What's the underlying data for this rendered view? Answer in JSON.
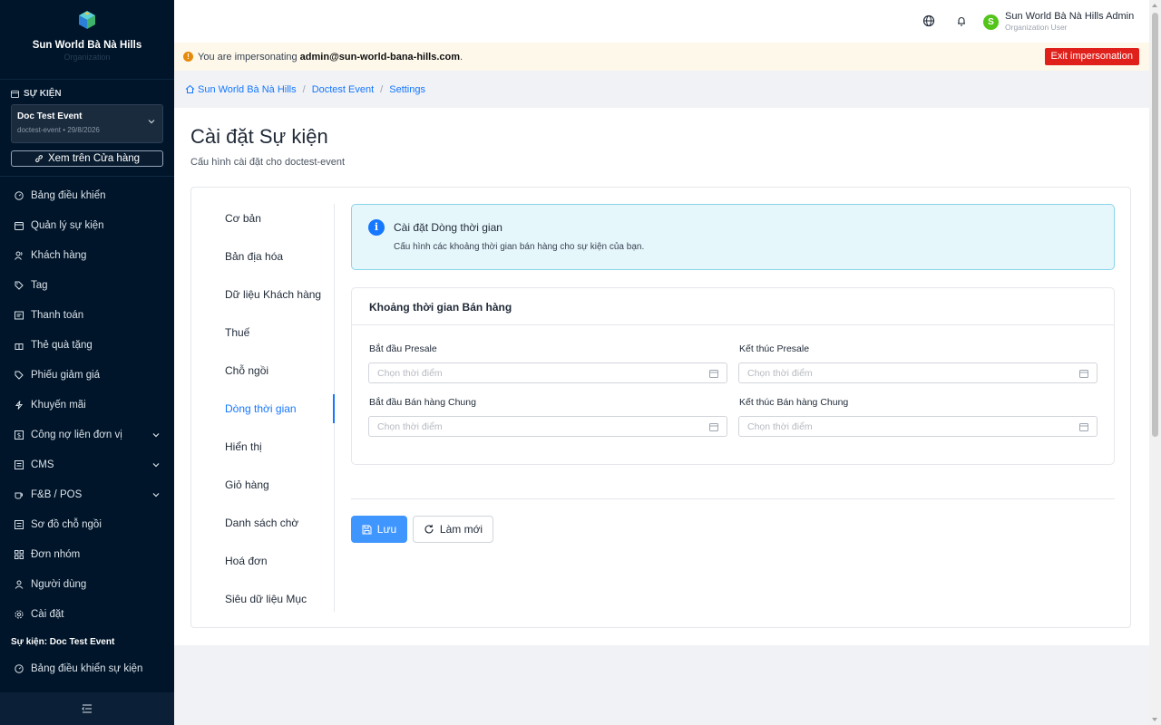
{
  "sidebar": {
    "org_name": "Sun World Bà Nà Hills",
    "org_subtitle": "Organization",
    "section_title": "SỰ KIỆN",
    "event_name": "Doc Test Event",
    "event_meta": "doctest-event • 29/8/2026",
    "store_button": "Xem trên Cửa hàng",
    "nav": [
      {
        "label": "Bảng điều khiển",
        "icon": "dashboard-icon"
      },
      {
        "label": "Quản lý sự kiện",
        "icon": "calendar-icon"
      },
      {
        "label": "Khách hàng",
        "icon": "users-icon"
      },
      {
        "label": "Tag",
        "icon": "tag-icon"
      },
      {
        "label": "Thanh toán",
        "icon": "payment-icon"
      },
      {
        "label": "Thẻ quà tặng",
        "icon": "gift-icon"
      },
      {
        "label": "Phiếu giảm giá",
        "icon": "coupon-icon"
      },
      {
        "label": "Khuyến mãi",
        "icon": "promotion-icon"
      },
      {
        "label": "Công nợ liên đơn vị",
        "icon": "ledger-icon",
        "expandable": true
      },
      {
        "label": "CMS",
        "icon": "cms-icon",
        "expandable": true
      },
      {
        "label": "F&B / POS",
        "icon": "coffee-icon",
        "expandable": true
      },
      {
        "label": "Sơ đồ chỗ ngồi",
        "icon": "seatmap-icon"
      },
      {
        "label": "Đơn nhóm",
        "icon": "group-order-icon"
      },
      {
        "label": "Người dùng",
        "icon": "user-icon"
      },
      {
        "label": "Cài đặt",
        "icon": "settings-icon"
      }
    ],
    "event_section": "Sự kiện: Doc Test Event",
    "event_nav": [
      {
        "label": "Bảng điều khiển sự kiện",
        "icon": "dashboard-icon"
      }
    ]
  },
  "header": {
    "user_initial": "S",
    "user_name": "Sun World Bà Nà Hills Admin",
    "user_role": "Organization User"
  },
  "impersonation": {
    "prefix": "You are impersonating",
    "email": "admin@sun-world-bana-hills.com",
    "suffix": ".",
    "exit_label": "Exit impersonation"
  },
  "breadcrumb": [
    "Sun World Bà Nà Hills",
    "Doctest Event",
    "Settings"
  ],
  "page": {
    "title": "Cài đặt Sự kiện",
    "subtitle": "Cấu hình cài đặt cho doctest-event"
  },
  "tabs": [
    {
      "label": "Cơ bản",
      "active": false
    },
    {
      "label": "Bản địa hóa",
      "active": false
    },
    {
      "label": "Dữ liệu Khách hàng",
      "active": false
    },
    {
      "label": "Thuế",
      "active": false
    },
    {
      "label": "Chỗ ngồi",
      "active": false
    },
    {
      "label": "Dòng thời gian",
      "active": true
    },
    {
      "label": "Hiển thị",
      "active": false
    },
    {
      "label": "Giỏ hàng",
      "active": false
    },
    {
      "label": "Danh sách chờ",
      "active": false
    },
    {
      "label": "Hoá đơn",
      "active": false
    },
    {
      "label": "Siêu dữ liệu Mục",
      "active": false
    }
  ],
  "info": {
    "title": "Cài đặt Dòng thời gian",
    "description": "Cấu hình các khoảng thời gian bán hàng cho sự kiện của bạn."
  },
  "sales_period": {
    "heading": "Khoảng thời gian Bán hàng",
    "presale_start_label": "Bắt đầu Presale",
    "presale_end_label": "Kết thúc Presale",
    "general_start_label": "Bắt đầu Bán hàng Chung",
    "general_end_label": "Kết thúc Bán hàng Chung",
    "placeholder": "Chọn thời điểm"
  },
  "actions": {
    "save": "Lưu",
    "reset": "Làm mới"
  },
  "colors": {
    "sidebar_bg": "#001529",
    "primary": "#1677ff",
    "danger": "#e0201b",
    "info_bg": "#e6f7fb",
    "avatar": "#52c41a"
  }
}
